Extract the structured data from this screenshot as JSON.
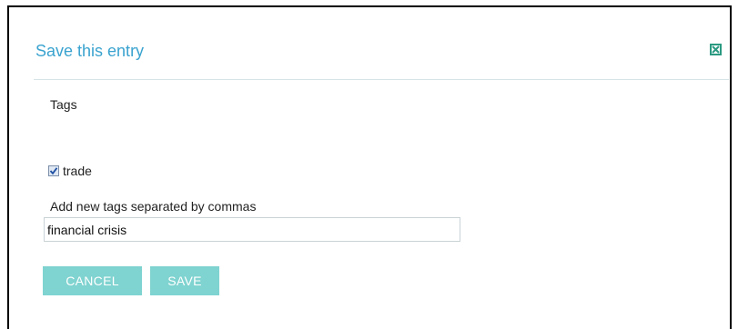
{
  "dialog": {
    "title": "Save this entry",
    "close_icon": "close-x-icon"
  },
  "tags": {
    "heading": "Tags",
    "existing": [
      {
        "label": "trade",
        "checked": true
      }
    ],
    "new_tags_label": "Add new tags separated by commas",
    "new_tags_value": "financial crisis"
  },
  "actions": {
    "cancel_label": "CANCEL",
    "save_label": "SAVE"
  },
  "colors": {
    "title": "#3aa3cf",
    "button_bg": "#7fd3d0",
    "close_icon": "#2b9a82"
  }
}
